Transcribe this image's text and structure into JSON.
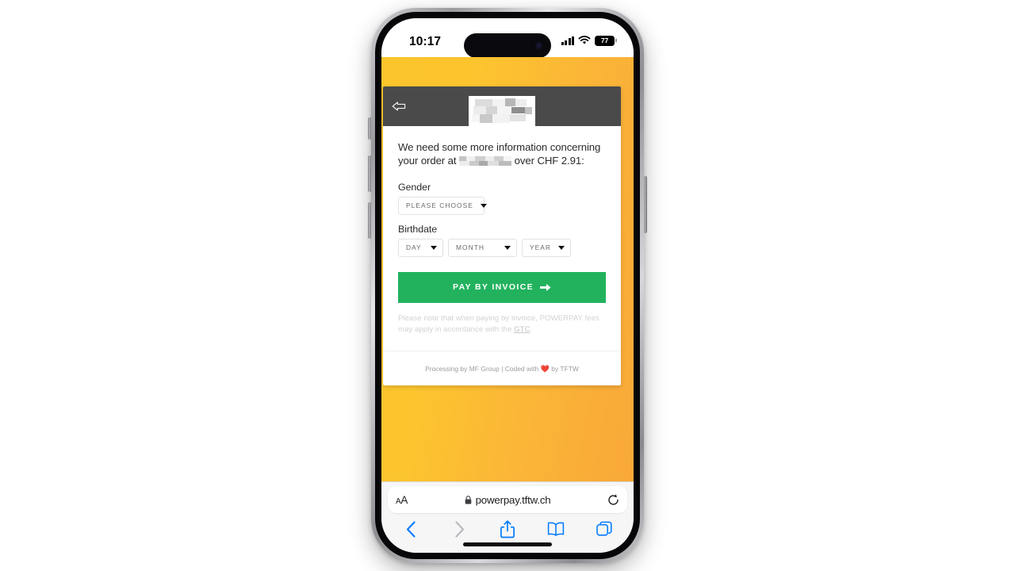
{
  "device": {
    "status_bar": {
      "time": "10:17",
      "cellular_icon": "cellular-signal-icon",
      "wifi_icon": "wifi-icon",
      "battery_icon": "battery-icon",
      "battery_level": "77"
    },
    "home_indicator": "home-indicator"
  },
  "page": {
    "background_gradient_from": "#fbc52c",
    "background_gradient_to": "#f9a838",
    "card": {
      "header": {
        "back_icon": "back-arrow-icon",
        "logo": "merchant-logo-redacted"
      },
      "lead_text_before": "We need some more information concerning your order at",
      "merchant_redacted": "redacted-merchant-name",
      "lead_text_after": "over CHF 2.91:",
      "fields": [
        {
          "label": "Gender",
          "name": "gender",
          "selects": [
            {
              "name": "gender-select",
              "value": "PLEASE CHOOSE"
            }
          ]
        },
        {
          "label": "Birthdate",
          "name": "birthdate",
          "selects": [
            {
              "name": "day-select",
              "value": "DAY"
            },
            {
              "name": "month-select",
              "value": "MONTH"
            },
            {
              "name": "year-select",
              "value": "YEAR"
            }
          ]
        }
      ],
      "pay_button": {
        "label": "PAY BY INVOICE",
        "icon": "arrow-right-icon",
        "color": "#22b25e"
      },
      "disclaimer_before": "Please note that when paying by invoice, POWERPAY fees may apply in accordance with the ",
      "disclaimer_link": "GTC",
      "disclaimer_after": ".",
      "footer_before": "Processing by MF Group | Coded with ",
      "footer_heart": "❤️",
      "footer_after": " by TFTW"
    }
  },
  "browser": {
    "text_size_button": "AA",
    "lock_icon": "lock-icon",
    "url": "powerpay.tftw.ch",
    "reload_icon": "reload-icon",
    "toolbar": [
      {
        "name": "back-button",
        "icon": "chevron-left-icon",
        "enabled": true
      },
      {
        "name": "forward-button",
        "icon": "chevron-right-icon",
        "enabled": false
      },
      {
        "name": "share-button",
        "icon": "share-icon",
        "enabled": true
      },
      {
        "name": "bookmarks-button",
        "icon": "book-icon",
        "enabled": true
      },
      {
        "name": "tabs-button",
        "icon": "tabs-icon",
        "enabled": true
      }
    ]
  }
}
